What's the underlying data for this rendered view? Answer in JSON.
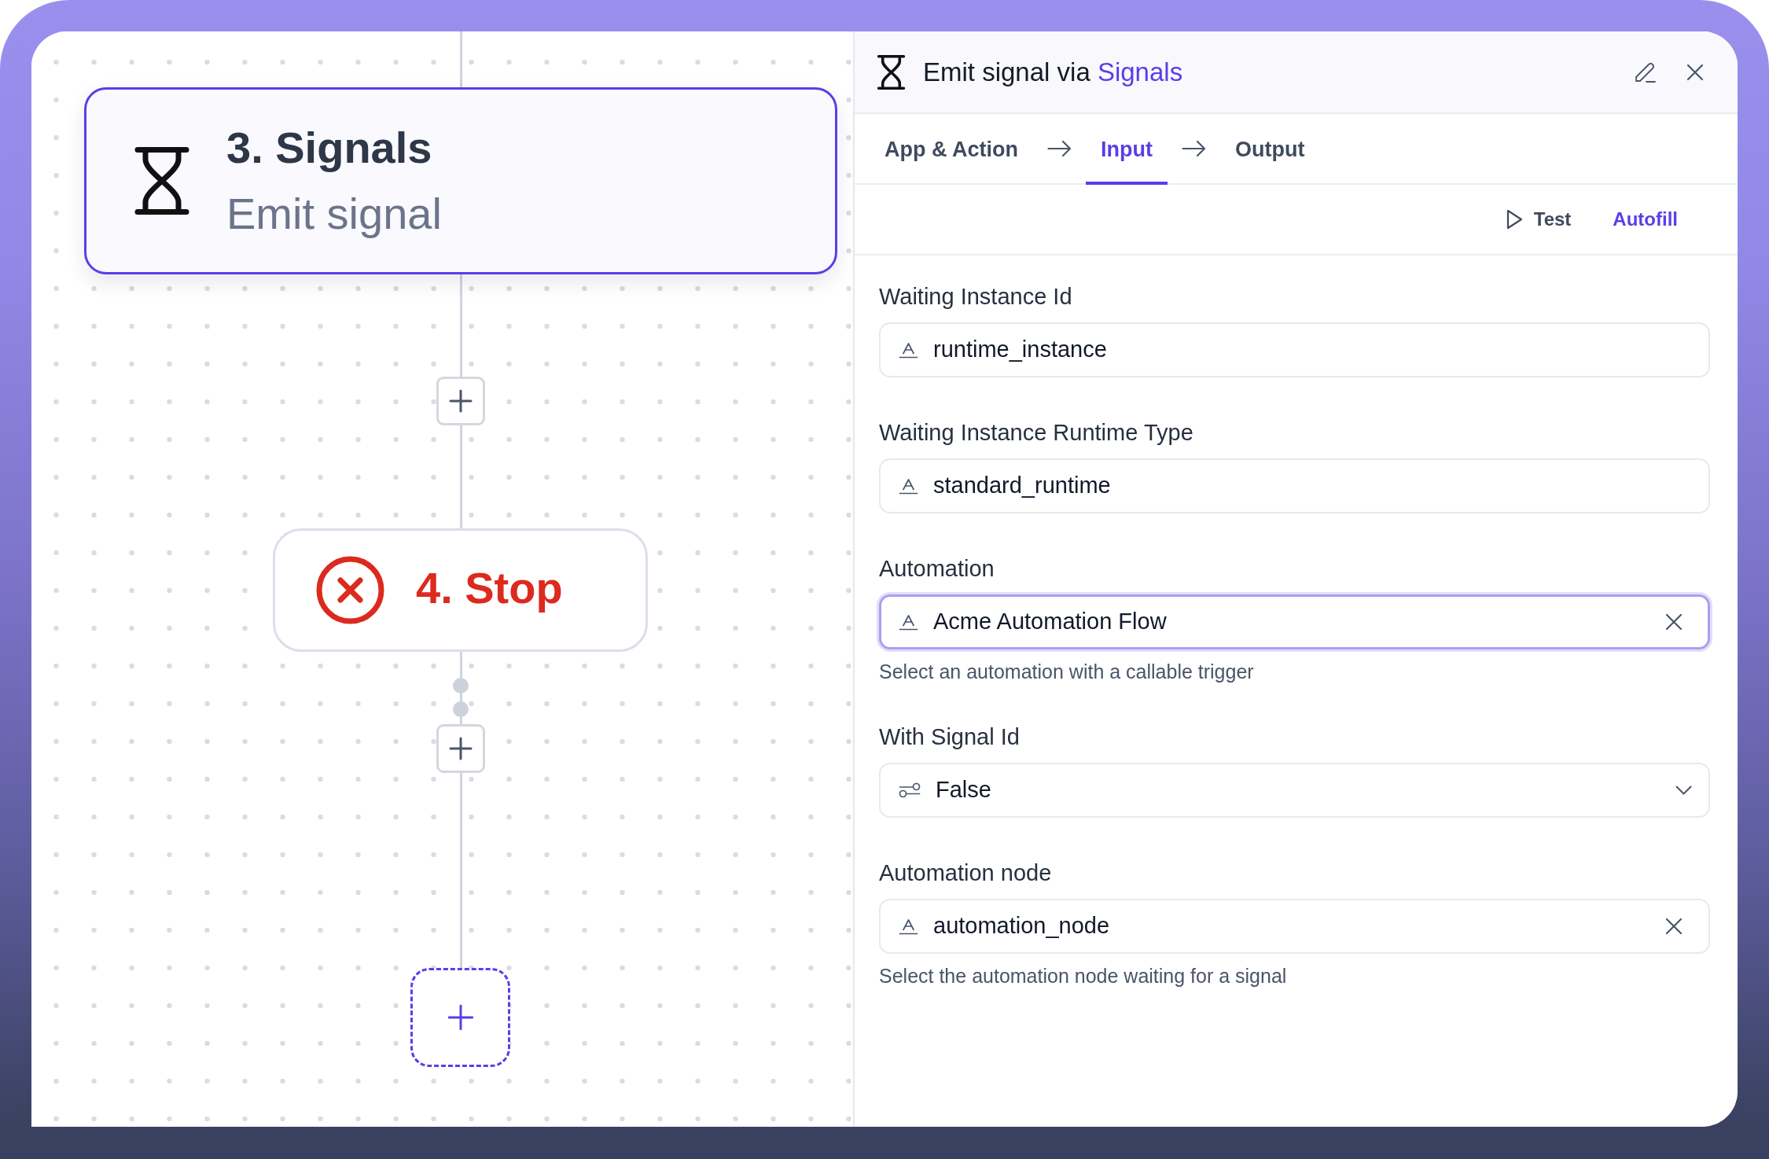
{
  "canvas": {
    "nodes": [
      {
        "kind": "action",
        "title": "3. Signals",
        "subtitle": "Emit signal",
        "selected": true
      },
      {
        "kind": "stop",
        "title": "4. Stop",
        "selected": false
      }
    ]
  },
  "panel": {
    "title": "Emit signal via",
    "app": "Signals",
    "tabs": [
      {
        "label": "App & Action",
        "selected": false
      },
      {
        "label": "Input",
        "selected": true
      },
      {
        "label": "Output",
        "selected": false
      }
    ],
    "actions": [
      {
        "kind": "test",
        "label": "Test"
      },
      {
        "kind": "autofill",
        "label": "Autofill"
      }
    ],
    "fields": [
      {
        "kind": "text",
        "label": "Waiting Instance Id",
        "value": "runtime_instance",
        "focused": false,
        "clearable": false
      },
      {
        "kind": "text",
        "label": "Waiting Instance Runtime Type",
        "value": "standard_runtime",
        "focused": false,
        "clearable": false
      },
      {
        "kind": "text",
        "label": "Automation",
        "value": "Acme Automation Flow",
        "focused": true,
        "clearable": true,
        "hint": "Select an automation with a callable trigger"
      },
      {
        "kind": "select",
        "label": "With Signal Id",
        "value": "False",
        "focused": false,
        "clearable": false
      },
      {
        "kind": "text",
        "label": "Automation node",
        "value": "automation_node",
        "focused": false,
        "clearable": true,
        "hint": "Select the automation node waiting for a signal"
      }
    ]
  }
}
